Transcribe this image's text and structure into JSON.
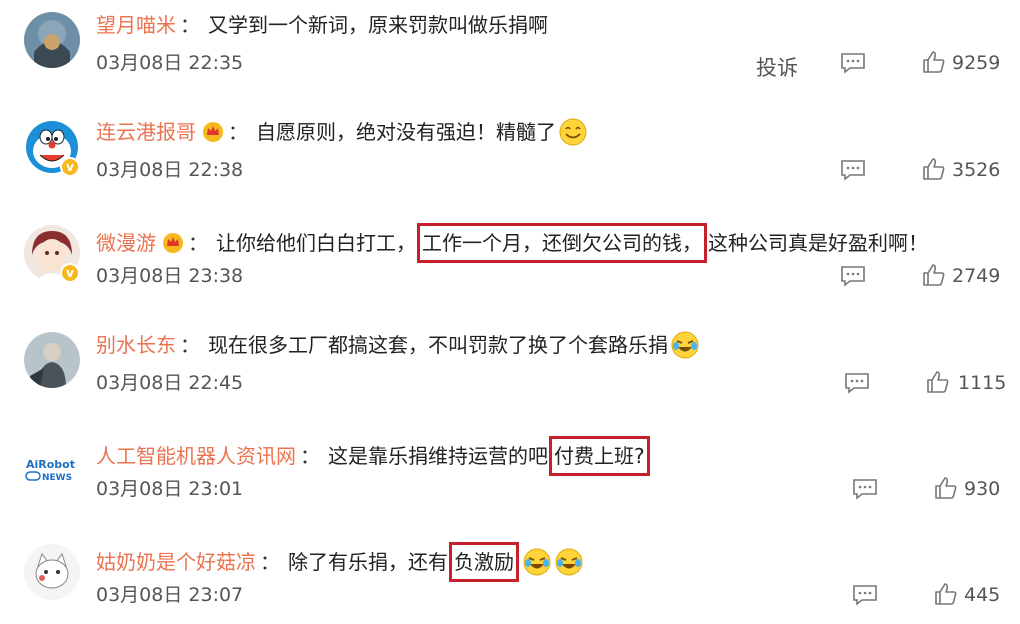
{
  "report_label": "投诉",
  "comments": [
    {
      "user": "望月喵米",
      "colon": "：",
      "parts": [
        "又学到一个新词，原来罚款叫做乐捐啊"
      ],
      "time": "03月08日 22:35",
      "likes": "9259"
    },
    {
      "user": "连云港报哥",
      "colon": "：",
      "parts": [
        "自愿原则，绝对没有强迫！精髓了"
      ],
      "time": "03月08日 22:38",
      "likes": "3526"
    },
    {
      "user": "微漫游",
      "colon": "：",
      "parts": [
        "让你给他们白白打工，",
        "工作一个月，还倒欠公司的钱，",
        "这种公司真是好盈利啊！"
      ],
      "time": "03月08日 23:38",
      "likes": "2749"
    },
    {
      "user": "别水长东",
      "colon": "：",
      "parts": [
        "现在很多工厂都搞这套，不叫罚款了换了个套路乐捐"
      ],
      "time": "03月08日 22:45",
      "likes": "1115"
    },
    {
      "user": "人工智能机器人资讯网",
      "colon": "：",
      "parts": [
        "这是靠乐捐维持运营的吧",
        "付费上班?"
      ],
      "time": "03月08日 23:01",
      "likes": "930",
      "avatar_text": [
        "AiRobot",
        "NEWS"
      ]
    },
    {
      "user": "姑奶奶是个好菇凉",
      "colon": "：",
      "parts": [
        "除了有乐捐，还有",
        "负激励"
      ],
      "time": "03月08日 23:07",
      "likes": "445"
    }
  ],
  "colors": {
    "username": "#eb7350",
    "highlight_box": "#c8202a",
    "badge": "#f5b91f"
  }
}
